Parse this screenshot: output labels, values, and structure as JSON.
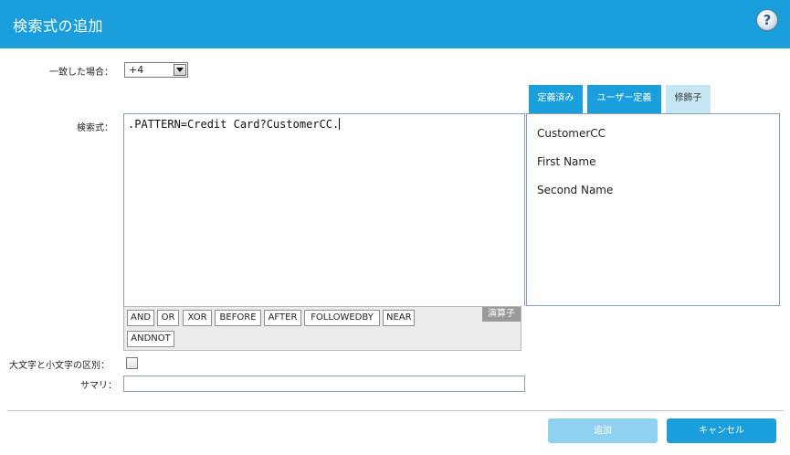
{
  "window": {
    "title": "検索式の追加",
    "help_label": "?"
  },
  "match": {
    "label": "一致した場合：",
    "value": "+4"
  },
  "expression": {
    "label": "検索式：",
    "value": ".PATTERN=Credit Card?CustomerCC."
  },
  "tabs": [
    {
      "label": "定義済み",
      "active": false
    },
    {
      "label": "ユーザー定義",
      "active": false
    },
    {
      "label": "修飾子",
      "active": true
    }
  ],
  "fields": [
    "CustomerCC",
    "First Name",
    "Second Name"
  ],
  "operators": {
    "tag": "演算子",
    "items": [
      "AND",
      "OR",
      "XOR",
      "BEFORE",
      "AFTER",
      "FOLLOWEDBY",
      "NEAR",
      "ANDNOT"
    ]
  },
  "case_sensitive": {
    "label": "大文字と小文字の区別：",
    "checked": false
  },
  "summary": {
    "label": "サマリ：",
    "value": ""
  },
  "buttons": {
    "add": "追加",
    "cancel": "キャンセル"
  },
  "colors": {
    "header": "#1a9fdc",
    "tab_active": "#c7e6f4",
    "button_disabled": "#8fd1ee"
  }
}
